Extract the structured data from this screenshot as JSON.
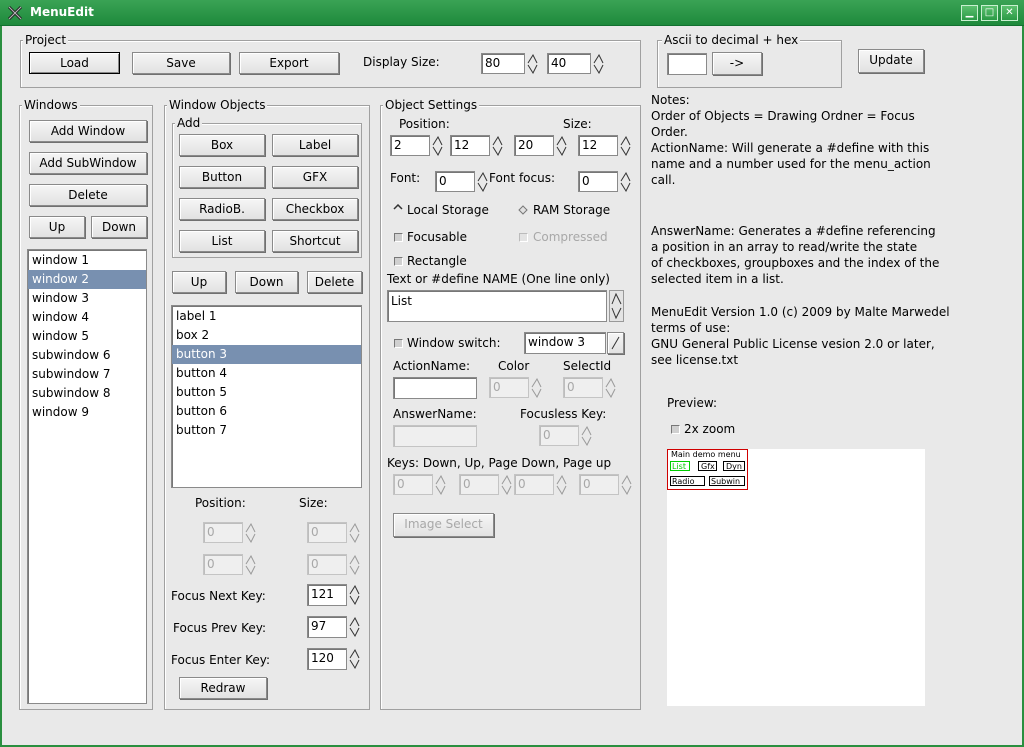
{
  "window": {
    "title": "MenuEdit"
  },
  "project": {
    "label": "Project",
    "load": "Load",
    "save": "Save",
    "export": "Export",
    "display_size_label": "Display Size:",
    "display_w": "80",
    "display_h": "40"
  },
  "ascii": {
    "label": "Ascii to decimal + hex",
    "input": "",
    "convert": "->"
  },
  "update": "Update",
  "windows": {
    "label": "Windows",
    "add_window": "Add Window",
    "add_subwindow": "Add SubWindow",
    "delete": "Delete",
    "up": "Up",
    "down": "Down",
    "items": [
      "window 1",
      "window 2",
      "window 3",
      "window 4",
      "window 5",
      "subwindow 6",
      "subwindow 7",
      "subwindow 8",
      "window 9"
    ],
    "selected_index": 1
  },
  "objects": {
    "label": "Window Objects",
    "add_label": "Add",
    "box": "Box",
    "label_btn": "Label",
    "button": "Button",
    "gfx": "GFX",
    "radio": "RadioB.",
    "checkbox": "Checkbox",
    "list": "List",
    "shortcut": "Shortcut",
    "up": "Up",
    "down": "Down",
    "delete": "Delete",
    "items": [
      "label 1",
      "box 2",
      "button 3",
      "button 4",
      "button 5",
      "button 6",
      "button 7"
    ],
    "selected_index": 2,
    "position_label": "Position:",
    "size_label": "Size:",
    "pos1": "0",
    "size1": "0",
    "pos2": "0",
    "size2": "0",
    "focus_next_label": "Focus Next Key:",
    "focus_next": "121",
    "focus_prev_label": "Focus Prev Key:",
    "focus_prev": "97",
    "focus_enter_label": "Focus Enter Key:",
    "focus_enter": "120",
    "redraw": "Redraw"
  },
  "settings": {
    "label": "Object Settings",
    "position_label": "Position:",
    "size_label": "Size:",
    "pos_x": "2",
    "pos_y": "12",
    "size_w": "20",
    "size_h": "12",
    "font_label": "Font:",
    "font": "0",
    "font_focus_label": "Font focus:",
    "font_focus": "0",
    "local_storage": "Local Storage",
    "ram_storage": "RAM Storage",
    "focusable": "Focusable",
    "compressed": "Compressed",
    "rectangle": "Rectangle",
    "text_label": "Text or #define NAME (One line only)",
    "text_value": "List",
    "window_switch_label": "Window switch:",
    "window_switch": "window 3",
    "action_name_label": "ActionName:",
    "color_label": "Color",
    "select_id_label": "SelectId",
    "color": "0",
    "select_id": "0",
    "answer_name_label": "AnswerName:",
    "focusless_key_label": "Focusless Key:",
    "focusless_key": "0",
    "keys_label": "Keys: Down, Up, Page Down, Page up",
    "keys": [
      "0",
      "0",
      "0",
      "0"
    ],
    "image_select": "Image Select"
  },
  "notes": {
    "title": "Notes:",
    "lines1": [
      "Order of Objects = Drawing Ordner = Focus",
      "Order.",
      "ActionName: Will generate a #define with this",
      "name and a number used for the menu_action",
      "call."
    ],
    "lines2": [
      "AnswerName: Generates a #define referencing",
      "a position in an array to read/write the state",
      "of checkboxes, groupboxes and the index of the",
      "selected item in a list."
    ],
    "lines3": [
      "MenuEdit Version 1.0 (c) 2009 by Malte Marwedel",
      "terms of use:",
      "GNU General Public License vesion 2.0 or later,",
      "see license.txt"
    ]
  },
  "preview": {
    "label": "Preview:",
    "zoom_label": "2x zoom",
    "menu_title": "Main demo menu",
    "btn_list": "List",
    "btn_gfx": "Gfx",
    "btn_dyn": "Dyn",
    "btn_radio": "Radio",
    "btn_subwin": "Subwin"
  },
  "colors": {
    "titlebar": "#2a9a45",
    "selection": "#7890b0",
    "preview_border": "#d00000",
    "preview_focus": "#00cc00"
  }
}
